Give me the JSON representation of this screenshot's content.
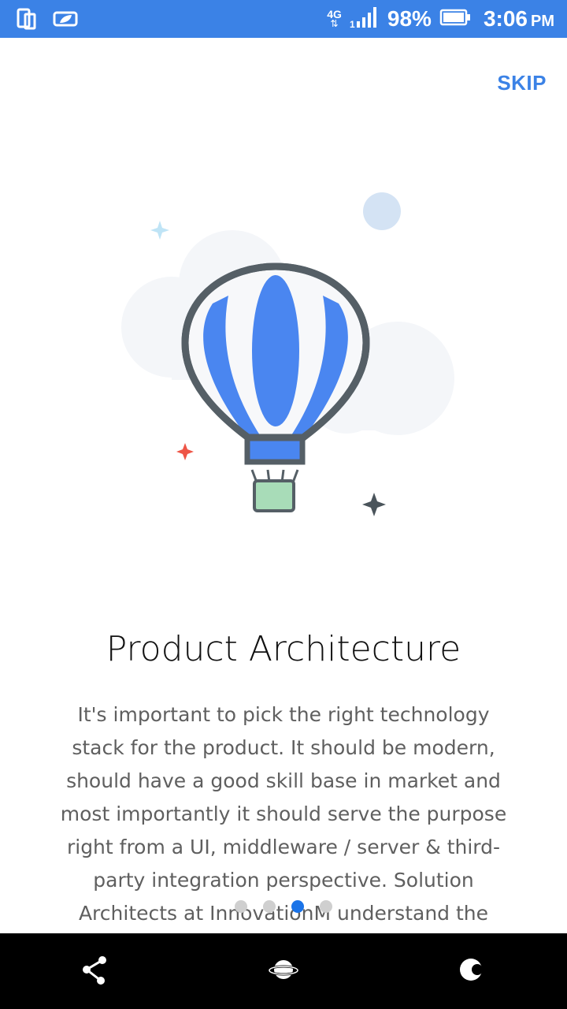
{
  "status_bar": {
    "network": "4G",
    "battery": "98%",
    "time": "3:06",
    "ampm": "PM"
  },
  "onboarding": {
    "skip_label": "SKIP",
    "title": "Product Architecture",
    "description": "It's important to pick the right technology stack for the product. It should be modern, should have a good skill base in market and most importantly it should serve the purpose right from a UI, middleware / server & third-party integration perspective. Solution Architects at InnovationM understand the",
    "page_count": 4,
    "active_page": 3
  },
  "nav": {
    "items": [
      "share-nav-icon",
      "planet-nav-icon",
      "moon-nav-icon"
    ]
  },
  "colors": {
    "accent": "#3b82e6",
    "balloon_blue": "#4a86f0",
    "outline": "#555f66",
    "basket": "#a8dcb8"
  }
}
